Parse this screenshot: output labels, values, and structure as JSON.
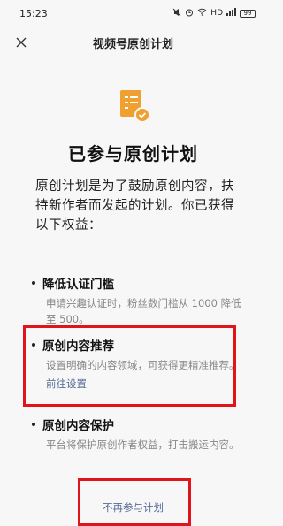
{
  "status_bar": {
    "time": "15:23",
    "network": "HD",
    "battery": "99",
    "icons": [
      "mute-icon",
      "alarm-icon",
      "wifi-icon",
      "signal-icon",
      "battery-icon"
    ]
  },
  "nav": {
    "title": "视频号原创计划",
    "close_icon": "close-icon"
  },
  "hero": {
    "icon": "document-check-icon",
    "icon_color": "#f0a030",
    "title": "已参与原创计划",
    "intro": "原创计划是为了鼓励原创内容，扶持新作者而发起的计划。你已获得以下权益："
  },
  "benefits": [
    {
      "title": "降低认证门槛",
      "desc": "申请兴趣认证时，粉丝数门槛从 1000 降低至 500。"
    },
    {
      "title": "原创内容推荐",
      "desc": "设置明确的内容领域，可获得更精准推荐。",
      "link": "前往设置"
    },
    {
      "title": "原创内容保护",
      "desc": "平台将保护原创作者权益，打击搬运内容。"
    }
  ],
  "footer": {
    "quit_label": "不再参与计划"
  },
  "colors": {
    "link": "#576b95",
    "highlight": "#e0151b",
    "background": "#f7f7f7"
  }
}
